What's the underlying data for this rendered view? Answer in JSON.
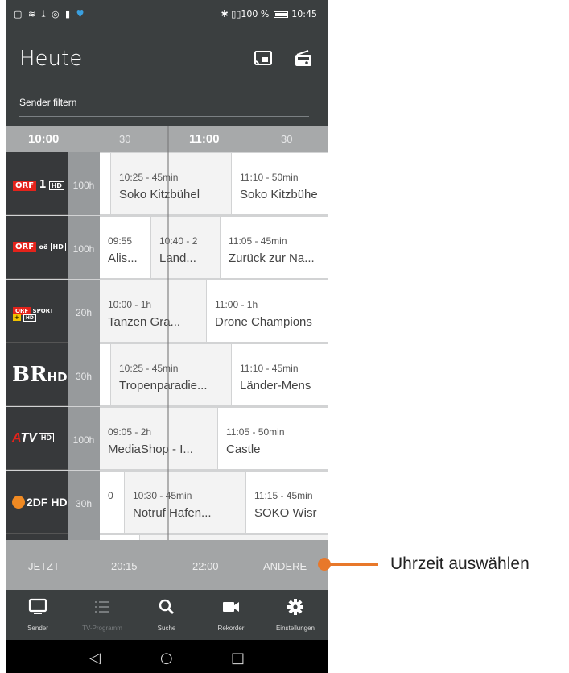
{
  "status_bar": {
    "battery": "100 %",
    "clock": "10:45"
  },
  "header": {
    "title": "Heute",
    "filter_placeholder": "Sender filtern"
  },
  "timeline": {
    "ticks": [
      "10:00",
      "30",
      "11:00",
      "30"
    ]
  },
  "channels": [
    {
      "logo": "ORF 1 HD",
      "count": "100h",
      "programs": [
        {
          "time": "10:25 - 45min",
          "title": "Soko Kitzbühel"
        },
        {
          "time": "11:10 - 50min",
          "title": "Soko Kitzbühe"
        }
      ]
    },
    {
      "logo": "ORF OÖ HD",
      "count": "100h",
      "programs": [
        {
          "time": "09:55",
          "title": "Alis..."
        },
        {
          "time": "10:40 - 2",
          "title": "Land..."
        },
        {
          "time": "11:05 - 45min",
          "title": "Zurück zur Na..."
        }
      ]
    },
    {
      "logo": "ORF SPORT+ HD",
      "count": "20h",
      "programs": [
        {
          "time": "10:00 - 1h",
          "title": "Tanzen Gra..."
        },
        {
          "time": "11:00 - 1h",
          "title": "Drone Champions"
        }
      ]
    },
    {
      "logo": "BR HD",
      "count": "30h",
      "programs": [
        {
          "time": "10:25 - 45min",
          "title": "Tropenparadie..."
        },
        {
          "time": "11:10 - 45min",
          "title": "Länder-Mens"
        }
      ]
    },
    {
      "logo": "ATV HD",
      "count": "100h",
      "programs": [
        {
          "time": "09:05 - 2h",
          "title": "MediaShop - I..."
        },
        {
          "time": "11:05 - 50min",
          "title": "Castle"
        }
      ]
    },
    {
      "logo": "ZDF HD",
      "count": "30h",
      "programs": [
        {
          "time": "0",
          "title": ""
        },
        {
          "time": "10:30 - 45min",
          "title": "Notruf Hafen..."
        },
        {
          "time": "11:15 - 45min",
          "title": "SOKO Wisr"
        }
      ]
    }
  ],
  "jump_bar": {
    "now": "JETZT",
    "t1": "20:15",
    "t2": "22:00",
    "other": "ANDERE"
  },
  "bottom_nav": [
    {
      "label": "Sender",
      "icon": "tv-icon"
    },
    {
      "label": "TV-Programm",
      "icon": "list-icon"
    },
    {
      "label": "Suche",
      "icon": "search-icon"
    },
    {
      "label": "Rekorder",
      "icon": "camera-icon"
    },
    {
      "label": "Einstellungen",
      "icon": "gear-icon"
    }
  ],
  "annotation": {
    "text": "Uhrzeit auswählen"
  },
  "colors": {
    "accent": "#e8782a",
    "header": "#3b3f40",
    "timebar": "#a7a9aa"
  }
}
